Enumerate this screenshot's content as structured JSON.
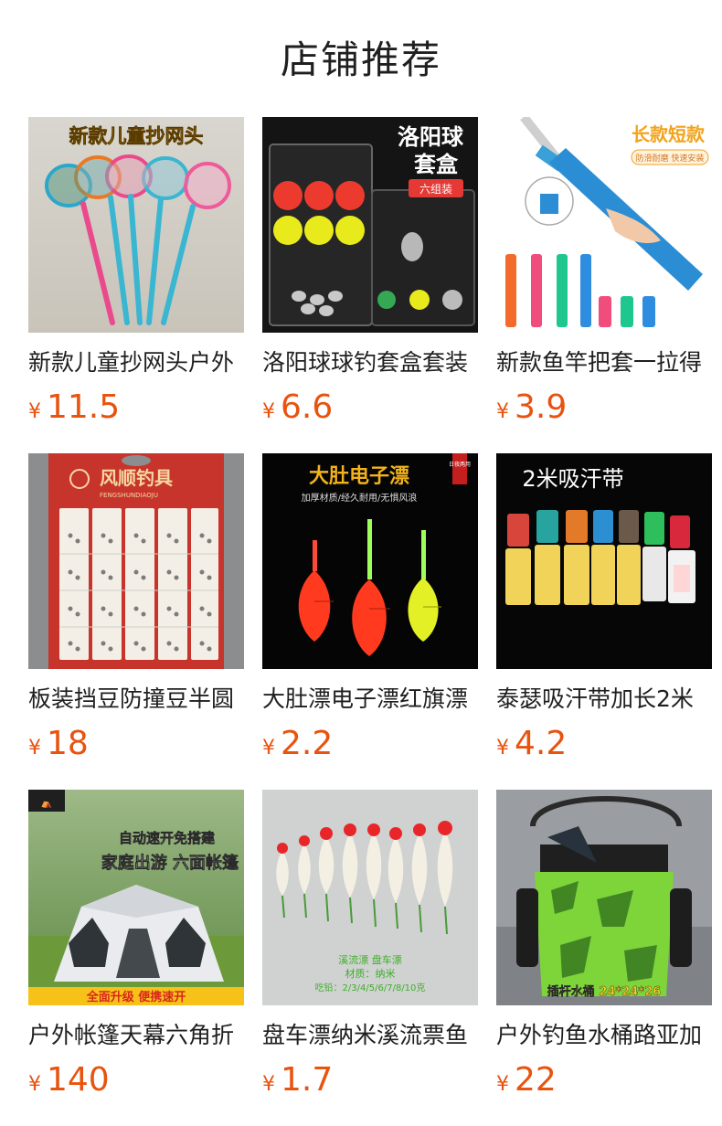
{
  "page": {
    "title": "店铺推荐"
  },
  "currency_symbol": "¥",
  "colors": {
    "price": "#e8530f",
    "text": "#1f1f1f",
    "background": "#ffffff"
  },
  "products": [
    {
      "name": "新款儿童抄网头户外",
      "price": "11.5",
      "image_text": [
        "新款儿童抄网头"
      ]
    },
    {
      "name": "洛阳球球钓套盒套装",
      "price": "6.6",
      "image_text": [
        "洛阳球",
        "套盒",
        "六组装"
      ]
    },
    {
      "name": "新款鱼竿把套一拉得",
      "price": "3.9",
      "image_text": [
        "长款短款",
        "防滑耐磨 快速安装"
      ]
    },
    {
      "name": "板装挡豆防撞豆半圆",
      "price": "18",
      "image_text": [
        "风顺钓具",
        "FENGSHUNDIAOJU"
      ]
    },
    {
      "name": "大肚漂电子漂红旗漂",
      "price": "2.2",
      "image_text": [
        "大肚电子漂",
        "加厚材质/经久耐用/无惧风浪",
        "日夜两用"
      ]
    },
    {
      "name": "泰瑟吸汗带加长2米",
      "price": "4.2",
      "image_text": [
        "2米吸汗带"
      ]
    },
    {
      "name": "户外帐篷天幕六角折",
      "price": "140",
      "image_text": [
        "自动速开免搭建",
        "家庭出游 六面帐篷",
        "全面升级  便携速开"
      ]
    },
    {
      "name": "盘车漂纳米溪流票鱼",
      "price": "1.7",
      "image_text": [
        "溪流漂 盘车漂",
        "材质：纳米",
        "吃铅：2/3/4/5/6/7/8/10克"
      ]
    },
    {
      "name": "户外钓鱼水桶路亚加",
      "price": "22",
      "image_text": [
        "插杆水桶 24*24*26"
      ]
    }
  ]
}
